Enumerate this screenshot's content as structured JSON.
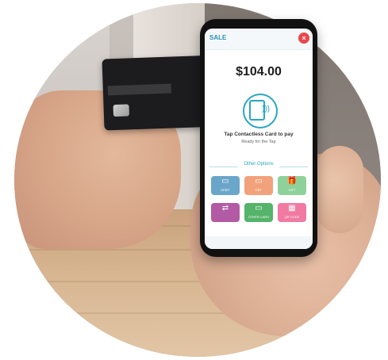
{
  "app": {
    "sale_title": "SALE",
    "close_symbol": "×"
  },
  "payment": {
    "amount": "$104.00",
    "tap_label": "Tap Contactless Card to pay",
    "tap_sublabel": "Ready for the Tap",
    "other_options_label": "Other Options"
  },
  "options": [
    {
      "label": "DEBIT",
      "icon": "card-icon",
      "color": "#6aa6c9"
    },
    {
      "label": "EBT",
      "icon": "card-icon",
      "color": "#f2a27a"
    },
    {
      "label": "GIFT",
      "icon": "gift-icon",
      "color": "#8fd19a"
    },
    {
      "label": "",
      "icon": "split-icon",
      "color": "#b35aa5"
    },
    {
      "label": "OTHER CARD",
      "icon": "card-icon",
      "color": "#55b36a"
    },
    {
      "label": "QR CODE",
      "icon": "qr-icon",
      "color": "#f07aa2"
    }
  ],
  "colors": {
    "accent": "#2aa6c2",
    "close": "#e9474b"
  }
}
